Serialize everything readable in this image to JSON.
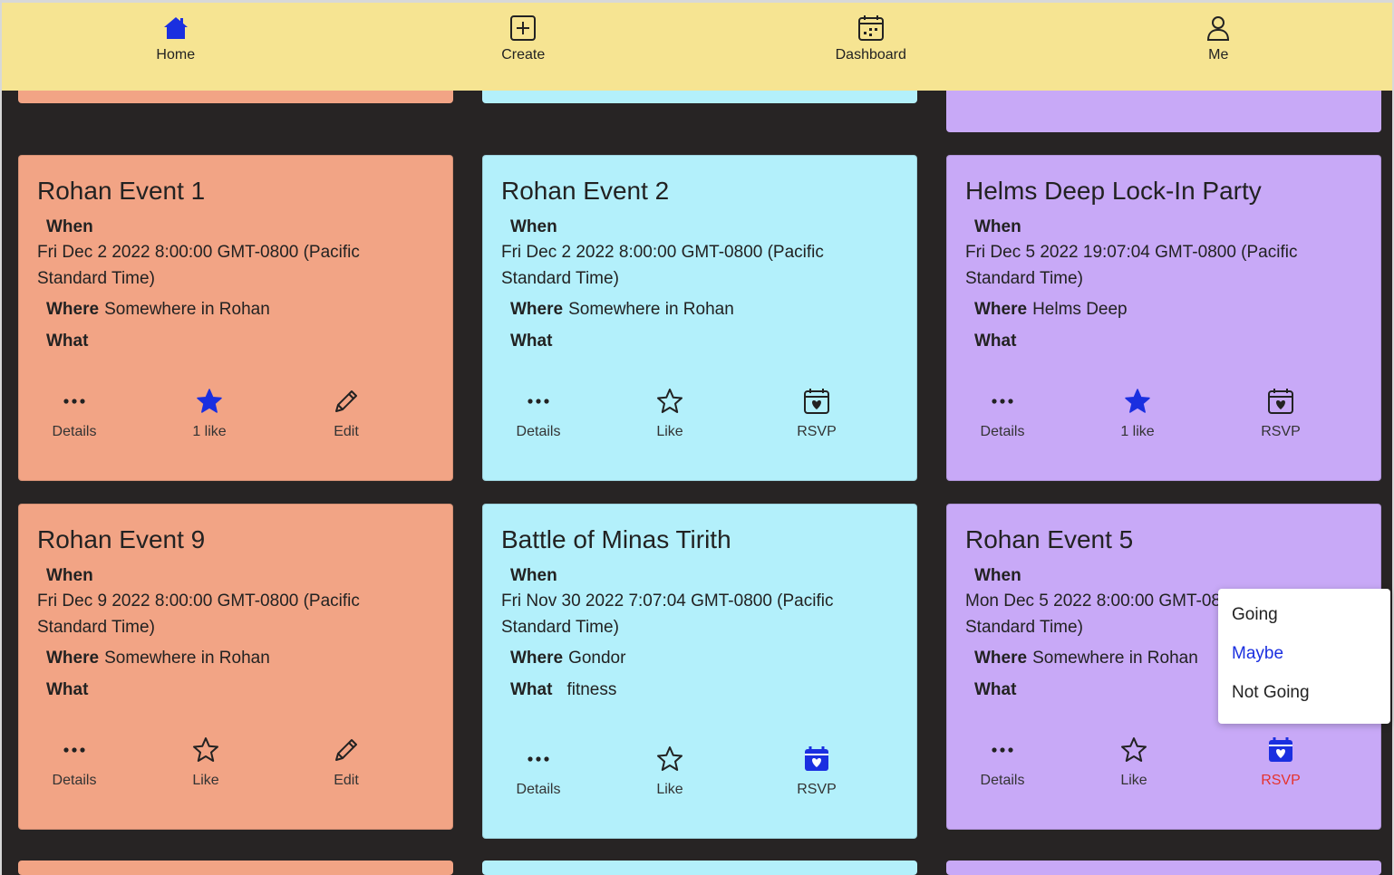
{
  "nav": {
    "home": "Home",
    "create": "Create",
    "dashboard": "Dashboard",
    "me": "Me"
  },
  "labels": {
    "when": "When",
    "where": "Where",
    "what": "What"
  },
  "cards": [
    {
      "title": "Rohan Event 1",
      "when": "Fri Dec 2 2022 8:00:00 GMT-0800 (Pacific Standard Time)",
      "where": "Somewhere in Rohan",
      "what": "",
      "a1": "Details",
      "a2": "1 like",
      "a3": "Edit"
    },
    {
      "title": "Rohan Event 2",
      "when": "Fri Dec 2 2022 8:00:00 GMT-0800 (Pacific Standard Time)",
      "where": "Somewhere in Rohan",
      "what": "",
      "a1": "Details",
      "a2": "Like",
      "a3": "RSVP"
    },
    {
      "title": "Helms Deep Lock-In Party",
      "when": "Fri Dec 5 2022 19:07:04 GMT-0800 (Pacific Standard Time)",
      "where": "Helms Deep",
      "what": "",
      "a1": "Details",
      "a2": "1 like",
      "a3": "RSVP"
    },
    {
      "title": "Rohan Event 9",
      "when": "Fri Dec 9 2022 8:00:00 GMT-0800 (Pacific Standard Time)",
      "where": "Somewhere in Rohan",
      "what": "",
      "a1": "Details",
      "a2": "Like",
      "a3": "Edit"
    },
    {
      "title": "Battle of Minas Tirith",
      "when": "Fri Nov 30 2022 7:07:04 GMT-0800 (Pacific Standard Time)",
      "where": "Gondor",
      "what": "fitness",
      "a1": "Details",
      "a2": "Like",
      "a3": "RSVP"
    },
    {
      "title": "Rohan Event 5",
      "when": "Mon Dec 5 2022 8:00:00 GMT-0800 (Pacific Standard Time)",
      "where": "Somewhere in Rohan",
      "what": "",
      "a1": "Details",
      "a2": "Like",
      "a3": "RSVP"
    }
  ],
  "rsvp_menu": {
    "options": [
      "Going",
      "Maybe",
      "Not Going"
    ],
    "selected": "Maybe"
  },
  "colors": {
    "background": "#272424",
    "nav": "#f6e492",
    "orange": "#f2a485",
    "cyan": "#b3f0fb",
    "purple": "#c8a9f7",
    "accent_blue": "#1a2fe0",
    "rsvp_active": "#e5322d"
  }
}
